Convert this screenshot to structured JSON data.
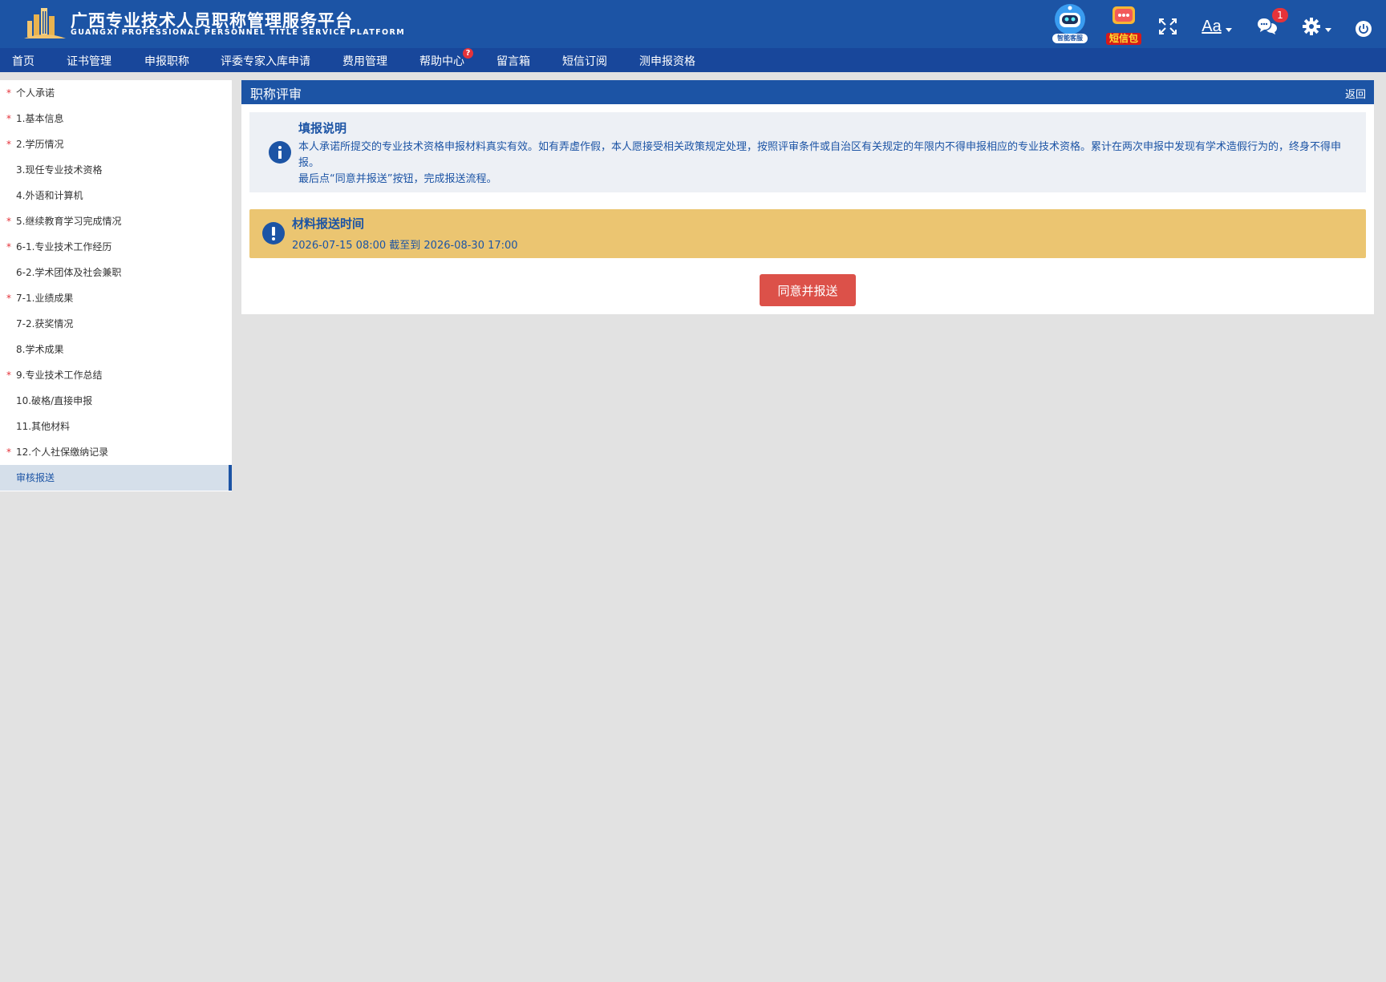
{
  "header": {
    "title_cn": "广西专业技术人员职称管理服务平台",
    "title_en": "GUANGXI PROFESSIONAL PERSONNEL TITLE SERVICE PLATFORM",
    "robot_label": "智能客服",
    "sms_label": "短信包",
    "font_label": "Aa",
    "chat_badge": "1",
    "brand_color": "#1c54a5"
  },
  "nav": {
    "items": [
      "首页",
      "证书管理",
      "申报职称",
      "评委专家入库申请",
      "费用管理",
      "帮助中心",
      "留言箱",
      "短信订阅",
      "测申报资格"
    ],
    "help_badge": "?"
  },
  "sidebar": {
    "items": [
      {
        "label": "个人承诺",
        "required": true
      },
      {
        "label": "1.基本信息",
        "required": true
      },
      {
        "label": "2.学历情况",
        "required": true
      },
      {
        "label": "3.现任专业技术资格",
        "required": false
      },
      {
        "label": "4.外语和计算机",
        "required": false
      },
      {
        "label": "5.继续教育学习完成情况",
        "required": true
      },
      {
        "label": "6-1.专业技术工作经历",
        "required": true
      },
      {
        "label": "6-2.学术团体及社会兼职",
        "required": false
      },
      {
        "label": "7-1.业绩成果",
        "required": true
      },
      {
        "label": "7-2.获奖情况",
        "required": false
      },
      {
        "label": "8.学术成果",
        "required": false
      },
      {
        "label": "9.专业技术工作总结",
        "required": true
      },
      {
        "label": "10.破格/直接申报",
        "required": false
      },
      {
        "label": "11.其他材料",
        "required": false
      },
      {
        "label": "12.个人社保缴纳记录",
        "required": true
      },
      {
        "label": "审核报送",
        "required": false,
        "active": true
      }
    ],
    "required_mark": "*"
  },
  "panel": {
    "title": "职称评审",
    "back": "返回",
    "info": {
      "title": "填报说明",
      "line1": "本人承诺所提交的专业技术资格申报材料真实有效。如有弄虚作假，本人愿接受相关政策规定处理，按照评审条件或自治区有关规定的年限内不得申报相应的专业技术资格。累计在两次申报中发现有学术造假行为的，终身不得申报。",
      "line2": "最后点“同意并报送”按钮，完成报送流程。"
    },
    "time": {
      "title": "材料报送时间",
      "range": "2026-07-15 08:00 截至到 2026-08-30 17:00"
    },
    "submit_label": "同意并报送"
  }
}
